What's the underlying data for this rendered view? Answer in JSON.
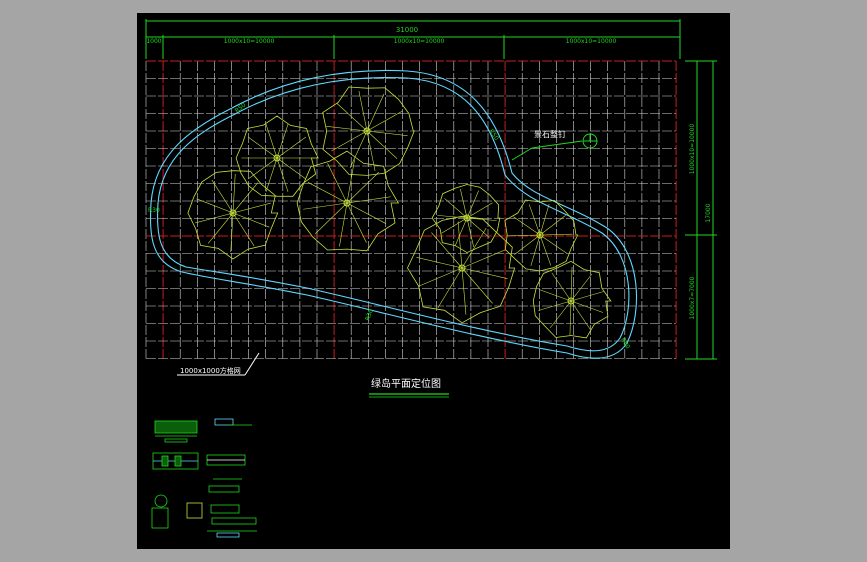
{
  "drawing": {
    "title": "绿岛平面定位图",
    "grid_note": "1000x1000方格网",
    "stone_label": "景石整钉",
    "dimensions": {
      "top_total": "31000",
      "top_first": "1000",
      "top_seg1": "1000x10=10000",
      "top_seg2": "1000x10=10000",
      "top_seg3": "1000x10=10000",
      "right_total": "17000",
      "right_upper": "1000x10=10000",
      "right_lower": "1000x7=7000"
    },
    "curve_labels": {
      "a": "R50",
      "b": "R50",
      "c": "R30",
      "d": "R30",
      "e": "R80"
    }
  },
  "colors": {
    "background": "#000000",
    "grid_white": "#d8d8d8",
    "grid_red": "#c81e1e",
    "dimension": "#1fd81f",
    "tree": "#c8e03c",
    "boundary": "#5fd8ff",
    "title_underline": "#1fd81f"
  }
}
